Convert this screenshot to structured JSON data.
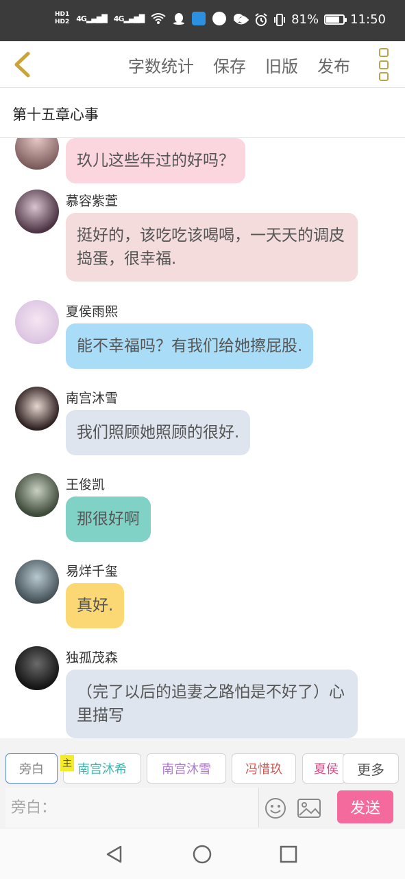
{
  "status_bar": {
    "hd1": "HD1",
    "hd2": "HD2",
    "sig1": "4G",
    "sig2": "4G",
    "battery_percent": "81%",
    "battery_level": 0.81,
    "time": "11:50"
  },
  "top_bar": {
    "actions": [
      "字数统计",
      "保存",
      "旧版",
      "发布"
    ]
  },
  "chapter": {
    "title": "第十五章心事"
  },
  "messages": [
    {
      "sender": "",
      "text": "玖儿这些年过的好吗？",
      "bubble_color": "#fbd6df"
    },
    {
      "sender": "慕容紫萱",
      "text": "挺好的，该吃吃该喝喝，一天天的调皮捣蛋，很幸福.",
      "bubble_color": "#f4dcdc"
    },
    {
      "sender": "夏侯雨熙",
      "text": "能不幸福吗？有我们给她擦屁股.",
      "bubble_color": "#a9dcf7"
    },
    {
      "sender": "南宫沐雪",
      "text": "我们照顾她照顾的很好.",
      "bubble_color": "#dfe5ee"
    },
    {
      "sender": "王俊凯",
      "text": "那很好啊",
      "bubble_color": "#7fd2c5"
    },
    {
      "sender": "易烊千玺",
      "text": "真好.",
      "bubble_color": "#fbd873"
    },
    {
      "sender": "独孤茂森",
      "text": "（完了以后的追妻之路怕是不好了）心里描写",
      "bubble_color": "#dfe5ee"
    }
  ],
  "input_panel": {
    "characters": [
      {
        "label": "旁白",
        "color": "#8a8a8a"
      },
      {
        "label": "南宫沐希",
        "color": "#3fb7b0"
      },
      {
        "label": "南宫沐雪",
        "color": "#b27bd1"
      },
      {
        "label": "冯惜玖",
        "color": "#d9534f"
      },
      {
        "label": "夏侯",
        "color": "#d94b8b"
      }
    ],
    "host_badge": "主",
    "more_label": "更多",
    "input_placeholder": "旁白：",
    "send_label": "发送"
  }
}
